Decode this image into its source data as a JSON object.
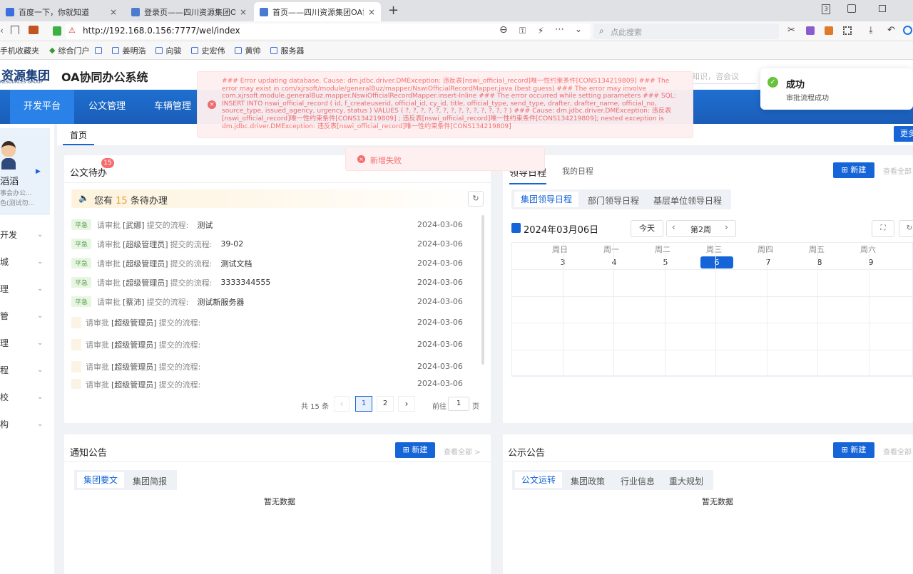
{
  "browser": {
    "tabs": [
      {
        "label": "百度一下，你就知道",
        "close": "×"
      },
      {
        "label": "登录页——四川资源集团OA协同",
        "close": "×"
      },
      {
        "label": "首页——四川资源集团OA协同",
        "close": "×"
      }
    ],
    "new_tab": "+",
    "url": "http://192.168.0.156:7777/wel/index",
    "search_placeholder": "点此搜索",
    "bookmarks": [
      "手机收藏夹",
      "综合门户",
      "姜明浩",
      "向骏",
      "史宏伟",
      "黄帅",
      "服务器"
    ],
    "tab_count": "3"
  },
  "app": {
    "logo_text": "资源集团",
    "logo_sub": "RESOURCES GROUP",
    "system_title": "OA协同办公系统",
    "header_search_placeholder": "知识，咨会议",
    "nav": [
      "开发平台",
      "公文管理",
      "车辆管理"
    ],
    "breadcrumb_tab": "首页",
    "more_btn": "更多",
    "user": {
      "name": "滔滔",
      "dept": "事会办公...",
      "role": "色(测试勿..."
    },
    "sidebar": [
      "开发",
      "城",
      "理",
      "管",
      "理",
      "程",
      "校",
      "构"
    ]
  },
  "error_toast": {
    "text": "### Error updating database. Cause: dm.jdbc.driver.DMException: 违反表[nswi_official_record]唯一性约束条件[CONS134219809] ### The error may exist in com/xjrsoft/module/generalBuz/mapper/NswiOfficialRecordMapper.java (best guess) ### The error may involve com.xjrsoft.module.generalBuz.mapper.NswiOfficialRecordMapper.insert-Inline ### The error occurred while setting parameters ### SQL: INSERT INTO nswi_official_record ( id, f_createuserid, official_id, cy_id, title, official_type, send_type, drafter, drafter_name, official_no, source_type, issued_agency, urgency, status ) VALUES ( ?, ?, ?, ?, ?, ?, ?, ?, ?, ?, ?, ?, ?, ? ) ### Cause: dm.jdbc.driver.DMException: 违反表[nswi_official_record]唯一性约束条件[CONS134219809] ; 违反表[nswi_official_record]唯一性约束条件[CONS134219809]; nested exception is dm.jdbc.driver.DMException: 违反表[nswi_official_record]唯一性约束条件[CONS134219809]",
    "fail_text": "新增失败"
  },
  "success_toast": {
    "title": "成功",
    "text": "审批流程成功"
  },
  "todo": {
    "title": "公文待办",
    "badge": "15",
    "banner_prefix": "您有",
    "banner_count": "15",
    "banner_suffix": "条待办理",
    "rows": [
      {
        "tag": "平急",
        "act": "请审批",
        "who": "[武娜]",
        "mid": "提交的流程:",
        "name": "测试",
        "date": "2024-03-06"
      },
      {
        "tag": "平急",
        "act": "请审批",
        "who": "[超级管理员]",
        "mid": "提交的流程:",
        "name": "39-02",
        "date": "2024-03-06"
      },
      {
        "tag": "平急",
        "act": "请审批",
        "who": "[超级管理员]",
        "mid": "提交的流程:",
        "name": "测试文档",
        "date": "2024-03-06"
      },
      {
        "tag": "平急",
        "act": "请审批",
        "who": "[超级管理员]",
        "mid": "提交的流程:",
        "name": "3333344555",
        "date": "2024-03-06"
      },
      {
        "tag": "平急",
        "act": "请审批",
        "who": "[蔡沛]",
        "mid": "提交的流程:",
        "name": "测试新服务器",
        "date": "2024-03-06"
      },
      {
        "tag": "",
        "act": "请审批",
        "who": "[超级管理员]",
        "mid": "提交的流程:",
        "name": "",
        "date": "2024-03-06"
      },
      {
        "tag": "",
        "act": "请审批",
        "who": "[超级管理员]",
        "mid": "提交的流程:",
        "name": "",
        "date": "2024-03-06"
      },
      {
        "tag": "",
        "act": "请审批",
        "who": "[超级管理员]",
        "mid": "提交的流程:",
        "name": "",
        "date": "2024-03-06"
      },
      {
        "tag": "",
        "act": "请审批",
        "who": "[超级管理员]",
        "mid": "提交的流程:",
        "name": "",
        "date": "2024-03-06"
      }
    ],
    "pagination": {
      "total": "共 15 条",
      "pages": [
        "1",
        "2"
      ],
      "goto_label": "前往",
      "goto_value": "1",
      "page_suffix": "页"
    }
  },
  "schedule": {
    "tab_active": "领导日程",
    "tab_mine": "我的日程",
    "new_btn": "新建",
    "view_all": "查看全部",
    "sub_tabs": [
      "集团领导日程",
      "部门领导日程",
      "基层单位领导日程"
    ],
    "date_label": "2024年03月06日",
    "today_btn": "今天",
    "week_label": "第2周",
    "days": [
      {
        "name": "周日",
        "num": "3"
      },
      {
        "name": "周一",
        "num": "4"
      },
      {
        "name": "周二",
        "num": "5"
      },
      {
        "name": "周三",
        "num": "6"
      },
      {
        "name": "周四",
        "num": "7"
      },
      {
        "name": "周五",
        "num": "8"
      },
      {
        "name": "周六",
        "num": "9"
      }
    ]
  },
  "notice": {
    "title": "通知公告",
    "new_btn": "新建",
    "view_all": "查看全部 >",
    "tabs": [
      "集团要文",
      "集团简报"
    ],
    "empty": "暂无数据"
  },
  "public": {
    "title": "公示公告",
    "new_btn": "新建",
    "view_all": "查看全部",
    "tabs": [
      "公文运转",
      "集团政策",
      "行业信息",
      "重大规划"
    ],
    "empty": "暂无数据"
  }
}
